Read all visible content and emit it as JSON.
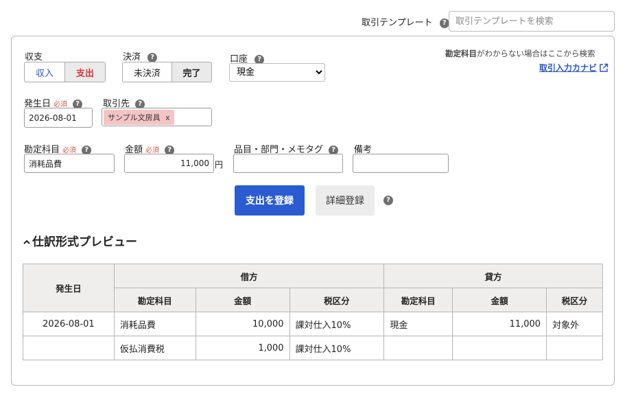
{
  "template": {
    "label": "取引テンプレート",
    "placeholder": "取引テンプレートを検索"
  },
  "income_expense": {
    "label": "収支",
    "options": [
      "収入",
      "支出"
    ],
    "selected": "支出"
  },
  "settlement": {
    "label": "決済",
    "options": [
      "未決済",
      "完了"
    ],
    "selected": "完了"
  },
  "account": {
    "label": "口座",
    "value": "現金"
  },
  "hint": {
    "strong": "勘定科目",
    "text": "がわからない場合はここから検索",
    "link": "取引入力カナビ"
  },
  "date": {
    "label": "発生日",
    "required": "必須",
    "value": "2026-08-01"
  },
  "partner": {
    "label": "取引先",
    "tag": "サンプル文房具",
    "tag_remove": "x"
  },
  "account_item": {
    "label": "勘定科目",
    "required": "必須",
    "value": "消耗品費"
  },
  "amount": {
    "label": "金額",
    "required": "必須",
    "value": "11,000",
    "unit": "円"
  },
  "item_tags": {
    "label": "品目・部門・メモタグ"
  },
  "remarks": {
    "label": "備考"
  },
  "buttons": {
    "register": "支出を登録",
    "detail": "詳細登録"
  },
  "preview": {
    "toggle_icon": "chevron-up-icon",
    "title": "仕訳形式プレビュー",
    "headers": {
      "date": "発生日",
      "debit": "借方",
      "credit": "貸方",
      "debit_cols": [
        "勘定科目",
        "金額",
        "税区分"
      ],
      "credit_cols": [
        "勘定科目",
        "金額",
        "税区分"
      ]
    },
    "rows": [
      {
        "date": "2026-08-01",
        "debit_account": "消耗品費",
        "debit_amount": "10,000",
        "debit_tax": "課対仕入10%",
        "credit_account": "現金",
        "credit_amount": "11,000",
        "credit_tax": "対象外"
      },
      {
        "date": "",
        "debit_account": "仮払消費税",
        "debit_amount": "1,000",
        "debit_tax": "課対仕入10%",
        "credit_account": "",
        "credit_amount": "",
        "credit_tax": ""
      }
    ]
  },
  "help_glyph": "?",
  "colors": {
    "primary_button": "#2b5bd0",
    "expense_active_text": "#d0393a",
    "income_text": "#2a56c6",
    "required_text": "#d9534f",
    "partner_tag_bg": "#f4c4c4",
    "link": "#2a56c6"
  }
}
